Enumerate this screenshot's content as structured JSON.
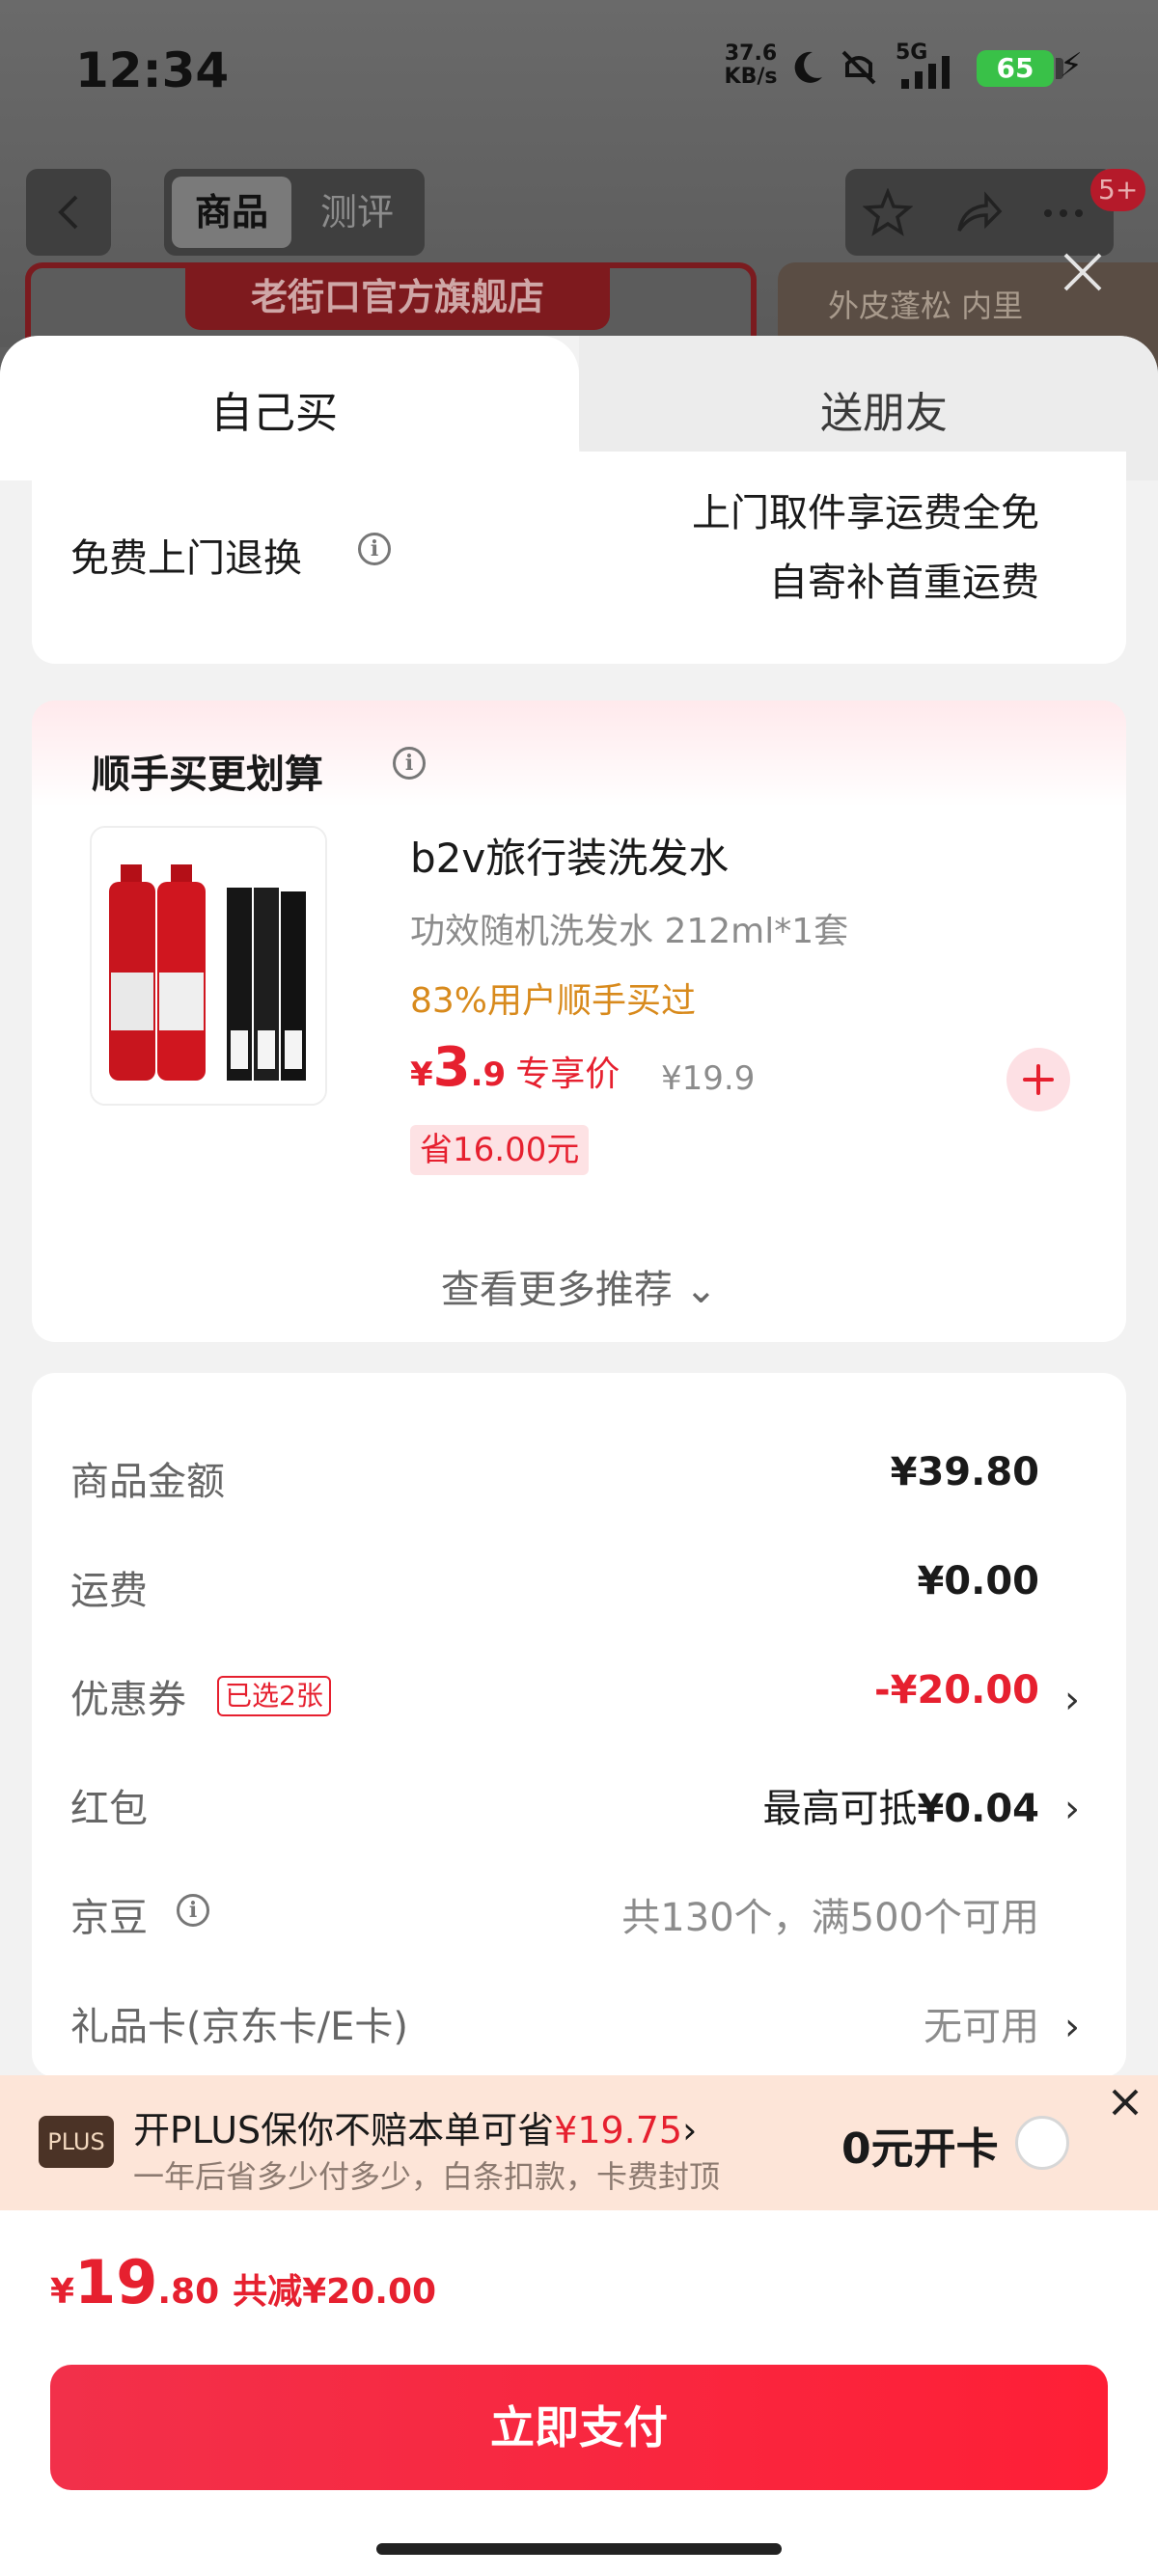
{
  "status_bar": {
    "time": "12:34",
    "net_speed_value": "37.6",
    "net_speed_unit": "KB/s",
    "network": "5G",
    "battery": "65"
  },
  "nav": {
    "tab_goods": "商品",
    "tab_review": "测评",
    "cart_badge": "5+",
    "icons": [
      "back-icon",
      "star-icon",
      "share-icon",
      "more-icon",
      "close-icon"
    ]
  },
  "background": {
    "store_banner": "老街口官方旗舰店",
    "side_banner": "外皮蓬松 内里"
  },
  "sheet_tabs": {
    "self_buy": "自己买",
    "gift": "送朋友"
  },
  "return_service": {
    "label": "免费上门退换",
    "line1": "上门取件享运费全免",
    "line2": "自寄补首重运费"
  },
  "recommend": {
    "title": "顺手买更划算",
    "product": {
      "name": "b2v旅行装洗发水",
      "spec": "功效随机洗发水 212ml*1套",
      "bought": "83%用户顺手买过",
      "price_symbol": "¥",
      "price_int": "3",
      "price_dec": ".9",
      "price_tag": "专享价",
      "original_price": "¥19.9",
      "save": "省16.00元"
    },
    "more": "查看更多推荐 ⌄"
  },
  "summary": {
    "rows": [
      {
        "label": "商品金额",
        "value": "¥39.80"
      },
      {
        "label": "运费",
        "value": "¥0.00"
      },
      {
        "label": "优惠券",
        "badge": "已选2张",
        "value": "-¥20.00"
      },
      {
        "label": "红包",
        "value_prefix": "最高可抵",
        "value": "¥0.04"
      },
      {
        "label": "京豆",
        "value": "共130个，满500个可用"
      },
      {
        "label": "礼品卡(京东卡/E卡)",
        "value": "无可用"
      }
    ]
  },
  "plus": {
    "logo": "PLUS",
    "title_prefix": "开PLUS保你不赔本单可省",
    "title_amount": "¥19.75",
    "title_chevron": "›",
    "subtitle": "一年后省多少付多少，白条扣款，卡费封顶",
    "open_label": "0元开卡"
  },
  "total": {
    "symbol": "¥",
    "int": "19",
    "dec": ".80",
    "reduce": "共减¥20.00",
    "pay_button": "立即支付"
  },
  "colors": {
    "accent_red": "#e6202f",
    "pay_button": "#fe1f36",
    "plus_bar_bg": "#fde5d8",
    "bought_orange": "#d88a1c"
  }
}
